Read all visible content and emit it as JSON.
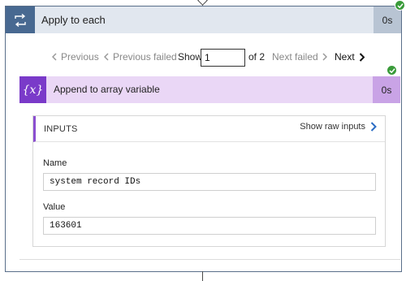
{
  "loop": {
    "title": "Apply to each",
    "duration": "0s",
    "icon": "loop-icon"
  },
  "pager": {
    "previous_label": "Previous",
    "previous_failed_label": "Previous failed",
    "show_label": "Show",
    "current_page": "1",
    "of_label": "of 2",
    "next_failed_label": "Next failed",
    "next_label": "Next"
  },
  "action": {
    "title": "Append to array variable",
    "duration": "0s",
    "icon_glyph": "{x}"
  },
  "inputs": {
    "header": "INPUTS",
    "show_raw_label": "Show raw inputs",
    "fields": [
      {
        "label": "Name",
        "value": "system record IDs"
      },
      {
        "label": "Value",
        "value": "163601"
      }
    ]
  },
  "colors": {
    "loop_accent": "#486991",
    "loop_header_bg": "#e1e7ef",
    "action_accent": "#7a3ac9",
    "action_header_bg": "#ead7f6",
    "success": "#3a9b3a",
    "link_blue": "#2b6cc4"
  }
}
